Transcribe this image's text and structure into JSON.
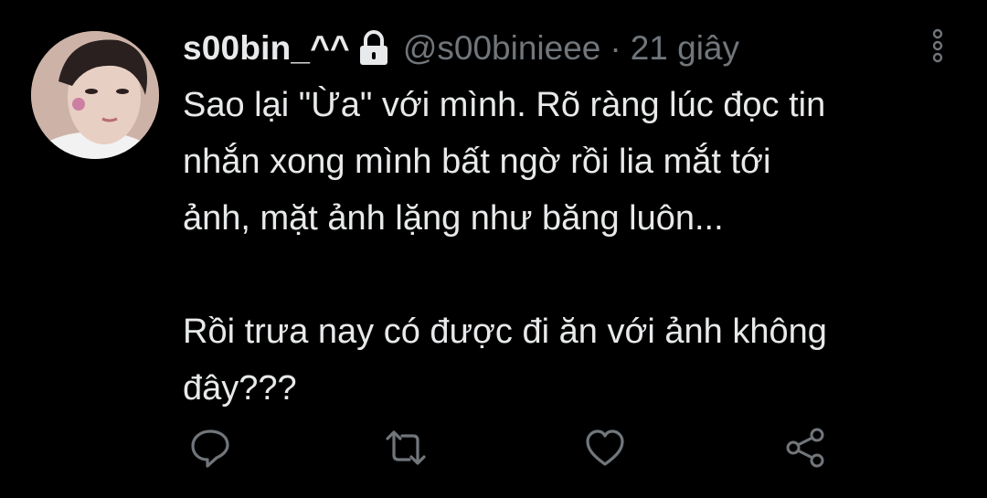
{
  "tweet": {
    "display_name": "s00bin_^^",
    "handle": "@s00binieee",
    "separator": "·",
    "timestamp": "21 giây",
    "paragraphs": [
      "Sao lại \"Ừa\" với mình. Rõ ràng lúc đọc tin\nnhắn xong mình bất ngờ rồi lia mắt tới\nảnh, mặt ảnh lặng như băng luôn...",
      "Rồi trưa nay có được đi ăn với ảnh không\nđây???"
    ]
  },
  "icons": {
    "protected": "lock-icon",
    "more": "more-vertical-icon",
    "reply": "reply-icon",
    "retweet": "retweet-icon",
    "like": "heart-icon",
    "share": "share-icon"
  },
  "colors": {
    "background": "#000000",
    "text_primary": "#e7e9ea",
    "text_secondary": "#71767b"
  }
}
